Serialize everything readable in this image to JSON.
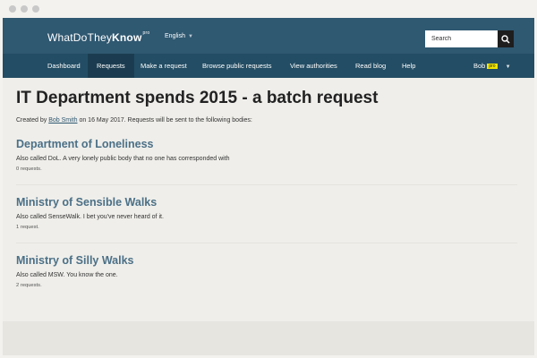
{
  "header": {
    "logo_regular": "WhatDoThey",
    "logo_bold": "Know",
    "logo_superscript": "pro",
    "language": "English",
    "search_placeholder": "Search"
  },
  "nav": {
    "items": [
      {
        "label": "Dashboard"
      },
      {
        "label": "Requests"
      },
      {
        "label": "Make a request"
      },
      {
        "label": "Browse public requests"
      },
      {
        "label": "View authorities"
      },
      {
        "label": "Read blog"
      },
      {
        "label": "Help"
      }
    ],
    "active": "Requests",
    "user_name": "Bob",
    "user_badge": "pro"
  },
  "page": {
    "title": "IT Department spends 2015 - a batch request",
    "created_prefix": "Created by",
    "author": "Bob Smith",
    "created_suffix": "on 16 May 2017. Requests will be sent to the following bodies:"
  },
  "bodies": [
    {
      "name": "Department of Loneliness",
      "description": "Also called DoL. A very lonely public body that no one has corresponded with",
      "count": "0 requests."
    },
    {
      "name": "Ministry of Sensible Walks",
      "description": "Also called SenseWalk. I bet you've never heard of it.",
      "count": "1 request."
    },
    {
      "name": "Ministry of Silly Walks",
      "description": "Also called MSW. You know the one.",
      "count": "2 requests."
    }
  ],
  "colors": {
    "header": "#2f5871",
    "nav": "#234d64",
    "nav_active": "#1b3c50",
    "body_link": "#4b7087",
    "pro_badge": "#f2e600"
  }
}
